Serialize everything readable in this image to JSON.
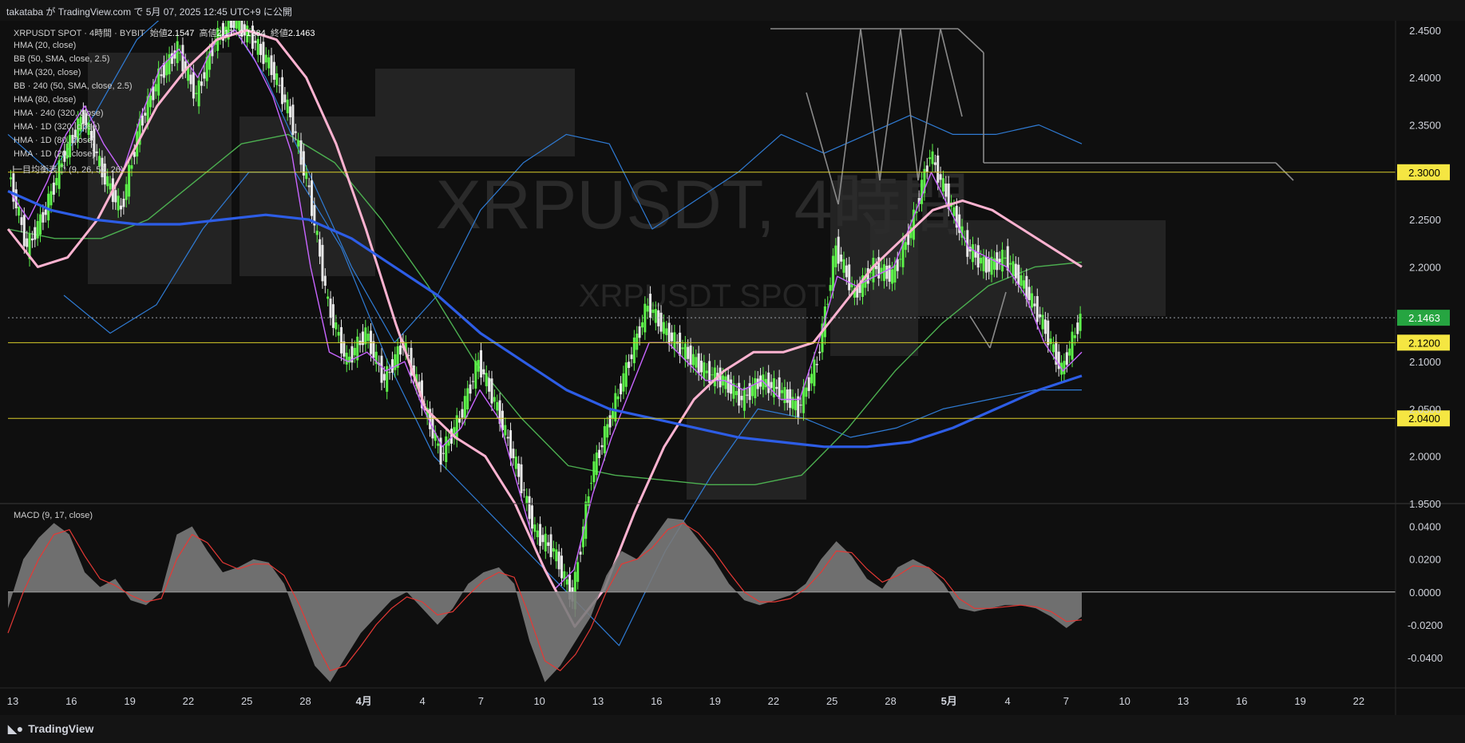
{
  "header": {
    "publish_info": "takataba が TradingView.com で 5月 07, 2025 12:45 UTC+9 に公開"
  },
  "legend": {
    "symbol": "XRPUSDT SPOT · 4時間 · BYBIT",
    "open_label": "始値",
    "open": "2.1547",
    "high_label": "高値",
    "high": "2.17",
    "low_label": "",
    "low": "2.1384",
    "close_label": "終値",
    "close": "2.1463",
    "indicators": [
      "HMA (20, close)",
      "BB (50, SMA, close, 2.5)",
      "HMA (320, close)",
      "BB · 240 (50, SMA, close, 2.5)",
      "HMA (80, close)",
      "HMA · 240 (320, close)",
      "HMA · 1D (320, close)",
      "HMA · 1D (80, close)",
      "HMA · 1D (20, close)",
      "一目均衡表◎ (9, 26, 52, 26)"
    ]
  },
  "watermark": {
    "title": "XRPUSDT, 4時間",
    "subtitle": "XRPUSDT SPOT"
  },
  "macd_label": "MACD (9, 17, close)",
  "footer": {
    "brand": "TradingView",
    "logo_icon": "tradingview-logo-icon"
  },
  "colors": {
    "background": "#0f0f0f",
    "bull_candle": "#5df24a",
    "bear_candle": "#e8e8e8",
    "hma_fast": "#c865ff",
    "hma_pink": "#ffb3d1",
    "hma_blue_thick": "#2d5de6",
    "bb_upper_lower": "#2f7bd4",
    "hma_green": "#4caf50",
    "cloud": "#3a3a3a",
    "hline": "#d8cc2a",
    "price_badge_current": "#26a541",
    "price_badge_level": "#f5e642",
    "macd_hist": "#7a7a7a",
    "macd_signal": "#e53935"
  },
  "chart_data": [
    {
      "type": "candlestick",
      "title": "XRPUSDT, 4時間",
      "y_axis_ticks": [
        "2.4500",
        "2.4000",
        "2.3500",
        "2.3000",
        "2.2500",
        "2.2000",
        "2.1500",
        "2.1000",
        "2.0500",
        "2.0000",
        "1.9500"
      ],
      "ylim": [
        1.95,
        2.46
      ],
      "x_axis_ticks": [
        "13",
        "16",
        "19",
        "22",
        "25",
        "28",
        "4月",
        "4",
        "7",
        "10",
        "13",
        "16",
        "19",
        "22",
        "25",
        "28",
        "5月",
        "4",
        "7",
        "10",
        "13",
        "16",
        "19",
        "22"
      ],
      "horizontal_levels": [
        {
          "value": 2.3,
          "label": "2.3000"
        },
        {
          "value": 2.12,
          "label": "2.1200"
        },
        {
          "value": 2.04,
          "label": "2.0400"
        }
      ],
      "current_price": {
        "value": 2.1463,
        "label": "2.1463"
      },
      "close_series": [
        2.3,
        2.22,
        2.26,
        2.32,
        2.36,
        2.3,
        2.26,
        2.35,
        2.4,
        2.43,
        2.38,
        2.44,
        2.46,
        2.44,
        2.41,
        2.36,
        2.28,
        2.16,
        2.1,
        2.13,
        2.08,
        2.12,
        2.06,
        2.0,
        2.04,
        2.1,
        2.05,
        1.99,
        1.92,
        1.9,
        1.85,
        1.98,
        2.04,
        2.1,
        2.16,
        2.13,
        2.11,
        2.09,
        2.08,
        2.06,
        2.08,
        2.07,
        2.05,
        2.1,
        2.22,
        2.17,
        2.2,
        2.19,
        2.24,
        2.32,
        2.27,
        2.22,
        2.2,
        2.21,
        2.18,
        2.14,
        2.09,
        2.146
      ],
      "hma_fast_series": [
        2.28,
        2.25,
        2.29,
        2.34,
        2.37,
        2.33,
        2.3,
        2.36,
        2.41,
        2.43,
        2.4,
        2.44,
        2.45,
        2.42,
        2.38,
        2.32,
        2.2,
        2.11,
        2.1,
        2.11,
        2.09,
        2.1,
        2.05,
        2.01,
        2.03,
        2.07,
        2.04,
        1.97,
        1.9,
        1.86,
        1.88,
        1.96,
        2.02,
        2.07,
        2.12,
        2.12,
        2.1,
        2.08,
        2.08,
        2.07,
        2.08,
        2.06,
        2.06,
        2.12,
        2.19,
        2.18,
        2.19,
        2.2,
        2.25,
        2.3,
        2.26,
        2.22,
        2.21,
        2.2,
        2.17,
        2.12,
        2.09,
        2.11
      ],
      "hma_pink_series": [
        2.24,
        2.2,
        2.21,
        2.25,
        2.31,
        2.37,
        2.41,
        2.44,
        2.45,
        2.44,
        2.4,
        2.33,
        2.24,
        2.14,
        2.05,
        2.02,
        2.0,
        1.95,
        1.88,
        1.82,
        1.86,
        1.94,
        2.01,
        2.06,
        2.09,
        2.11,
        2.11,
        2.12,
        2.16,
        2.2,
        2.23,
        2.26,
        2.27,
        2.26,
        2.24,
        2.22,
        2.2
      ],
      "hma_thick_series": [
        2.28,
        2.26,
        2.25,
        2.245,
        2.245,
        2.25,
        2.255,
        2.25,
        2.23,
        2.2,
        2.17,
        2.13,
        2.1,
        2.07,
        2.05,
        2.04,
        2.03,
        2.02,
        2.015,
        2.01,
        2.01,
        2.015,
        2.03,
        2.05,
        2.07,
        2.085
      ],
      "hma_green_series": [
        2.24,
        2.23,
        2.23,
        2.25,
        2.29,
        2.33,
        2.34,
        2.31,
        2.25,
        2.18,
        2.1,
        2.04,
        1.99,
        1.98,
        1.975,
        1.97,
        1.97,
        1.98,
        2.03,
        2.09,
        2.14,
        2.18,
        2.2,
        2.205
      ],
      "bb_upper_series": [
        2.34,
        2.3,
        2.36,
        2.44,
        2.48,
        2.47,
        2.4,
        2.3,
        2.2,
        2.12,
        2.17,
        2.26,
        2.31,
        2.34,
        2.33,
        2.24,
        2.27,
        2.3,
        2.34,
        2.32,
        2.34,
        2.36,
        2.34,
        2.34,
        2.35,
        2.33
      ],
      "bb_lower_series": [
        2.17,
        2.13,
        2.16,
        2.24,
        2.3,
        2.3,
        2.22,
        2.1,
        2.0,
        1.95,
        1.9,
        1.85,
        1.8,
        1.9,
        1.98,
        2.05,
        2.04,
        2.02,
        2.03,
        2.05,
        2.06,
        2.07,
        2.07
      ]
    },
    {
      "type": "area",
      "title": "MACD (9, 17, close)",
      "y_axis_ticks": [
        "0.0400",
        "0.0200",
        "0.0000",
        "-0.0200",
        "-0.0400"
      ],
      "ylim": [
        -0.058,
        0.05
      ],
      "histogram": [
        -0.01,
        0.02,
        0.033,
        0.042,
        0.035,
        0.012,
        0.003,
        0.008,
        -0.005,
        -0.008,
        0.0,
        0.035,
        0.04,
        0.025,
        0.012,
        0.015,
        0.02,
        0.018,
        0.005,
        -0.02,
        -0.045,
        -0.055,
        -0.04,
        -0.025,
        -0.015,
        -0.005,
        0.0,
        -0.01,
        -0.02,
        -0.01,
        0.005,
        0.012,
        0.015,
        0.005,
        -0.03,
        -0.055,
        -0.045,
        -0.03,
        -0.015,
        0.01,
        0.025,
        0.02,
        0.032,
        0.045,
        0.044,
        0.032,
        0.02,
        0.005,
        -0.005,
        -0.008,
        -0.005,
        -0.002,
        0.005,
        0.02,
        0.031,
        0.022,
        0.008,
        0.002,
        0.015,
        0.02,
        0.015,
        0.005,
        -0.01,
        -0.012,
        -0.01,
        -0.008,
        -0.008,
        -0.01,
        -0.015,
        -0.022,
        -0.015
      ],
      "signal": [
        -0.025,
        0.0,
        0.02,
        0.035,
        0.038,
        0.022,
        0.008,
        0.004,
        -0.002,
        -0.006,
        -0.004,
        0.02,
        0.035,
        0.03,
        0.018,
        0.014,
        0.017,
        0.017,
        0.01,
        -0.008,
        -0.03,
        -0.048,
        -0.045,
        -0.033,
        -0.02,
        -0.01,
        -0.003,
        -0.006,
        -0.014,
        -0.012,
        -0.002,
        0.007,
        0.012,
        0.009,
        -0.015,
        -0.042,
        -0.048,
        -0.038,
        -0.022,
        0.0,
        0.017,
        0.02,
        0.027,
        0.038,
        0.042,
        0.036,
        0.025,
        0.012,
        0.0,
        -0.006,
        -0.006,
        -0.004,
        0.002,
        0.012,
        0.025,
        0.024,
        0.014,
        0.006,
        0.01,
        0.016,
        0.015,
        0.008,
        -0.004,
        -0.01,
        -0.01,
        -0.009,
        -0.008,
        -0.009,
        -0.012,
        -0.018,
        -0.017
      ]
    }
  ]
}
